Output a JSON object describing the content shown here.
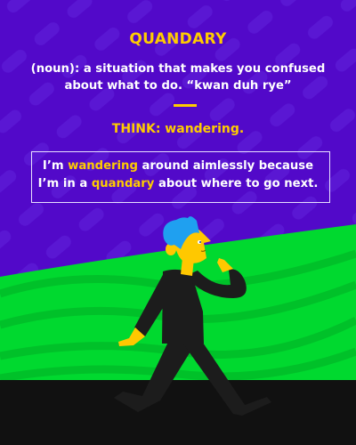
{
  "word": "QUANDARY",
  "definition": {
    "line1": "(noun): a situation that makes you confused",
    "line2": "about what to do. “kwan duh rye”"
  },
  "think": "THINK: wandering.",
  "sentence": {
    "l1_a": "I’m ",
    "l1_hl": "wandering",
    "l1_b": " around aimlessly because",
    "l2_a": "I’m in a ",
    "l2_hl": "quandary",
    "l2_b": " about where to go next."
  },
  "colors": {
    "background": "#5209c9",
    "accent": "#ffcc00",
    "grass": "#00d92f",
    "ground": "#111111",
    "hair": "#1fa0f0"
  },
  "illustration": "man-walking-thinking"
}
